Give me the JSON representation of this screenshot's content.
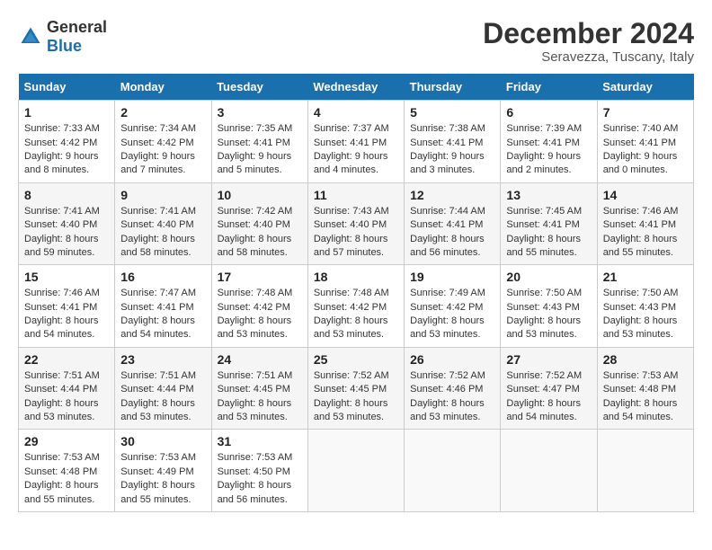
{
  "header": {
    "logo_general": "General",
    "logo_blue": "Blue",
    "month": "December 2024",
    "location": "Seravezza, Tuscany, Italy"
  },
  "weekdays": [
    "Sunday",
    "Monday",
    "Tuesday",
    "Wednesday",
    "Thursday",
    "Friday",
    "Saturday"
  ],
  "weeks": [
    [
      {
        "day": "1",
        "sunrise": "7:33 AM",
        "sunset": "4:42 PM",
        "daylight": "9 hours and 8 minutes."
      },
      {
        "day": "2",
        "sunrise": "7:34 AM",
        "sunset": "4:42 PM",
        "daylight": "9 hours and 7 minutes."
      },
      {
        "day": "3",
        "sunrise": "7:35 AM",
        "sunset": "4:41 PM",
        "daylight": "9 hours and 5 minutes."
      },
      {
        "day": "4",
        "sunrise": "7:37 AM",
        "sunset": "4:41 PM",
        "daylight": "9 hours and 4 minutes."
      },
      {
        "day": "5",
        "sunrise": "7:38 AM",
        "sunset": "4:41 PM",
        "daylight": "9 hours and 3 minutes."
      },
      {
        "day": "6",
        "sunrise": "7:39 AM",
        "sunset": "4:41 PM",
        "daylight": "9 hours and 2 minutes."
      },
      {
        "day": "7",
        "sunrise": "7:40 AM",
        "sunset": "4:41 PM",
        "daylight": "9 hours and 0 minutes."
      }
    ],
    [
      {
        "day": "8",
        "sunrise": "7:41 AM",
        "sunset": "4:40 PM",
        "daylight": "8 hours and 59 minutes."
      },
      {
        "day": "9",
        "sunrise": "7:41 AM",
        "sunset": "4:40 PM",
        "daylight": "8 hours and 58 minutes."
      },
      {
        "day": "10",
        "sunrise": "7:42 AM",
        "sunset": "4:40 PM",
        "daylight": "8 hours and 58 minutes."
      },
      {
        "day": "11",
        "sunrise": "7:43 AM",
        "sunset": "4:40 PM",
        "daylight": "8 hours and 57 minutes."
      },
      {
        "day": "12",
        "sunrise": "7:44 AM",
        "sunset": "4:41 PM",
        "daylight": "8 hours and 56 minutes."
      },
      {
        "day": "13",
        "sunrise": "7:45 AM",
        "sunset": "4:41 PM",
        "daylight": "8 hours and 55 minutes."
      },
      {
        "day": "14",
        "sunrise": "7:46 AM",
        "sunset": "4:41 PM",
        "daylight": "8 hours and 55 minutes."
      }
    ],
    [
      {
        "day": "15",
        "sunrise": "7:46 AM",
        "sunset": "4:41 PM",
        "daylight": "8 hours and 54 minutes."
      },
      {
        "day": "16",
        "sunrise": "7:47 AM",
        "sunset": "4:41 PM",
        "daylight": "8 hours and 54 minutes."
      },
      {
        "day": "17",
        "sunrise": "7:48 AM",
        "sunset": "4:42 PM",
        "daylight": "8 hours and 53 minutes."
      },
      {
        "day": "18",
        "sunrise": "7:48 AM",
        "sunset": "4:42 PM",
        "daylight": "8 hours and 53 minutes."
      },
      {
        "day": "19",
        "sunrise": "7:49 AM",
        "sunset": "4:42 PM",
        "daylight": "8 hours and 53 minutes."
      },
      {
        "day": "20",
        "sunrise": "7:50 AM",
        "sunset": "4:43 PM",
        "daylight": "8 hours and 53 minutes."
      },
      {
        "day": "21",
        "sunrise": "7:50 AM",
        "sunset": "4:43 PM",
        "daylight": "8 hours and 53 minutes."
      }
    ],
    [
      {
        "day": "22",
        "sunrise": "7:51 AM",
        "sunset": "4:44 PM",
        "daylight": "8 hours and 53 minutes."
      },
      {
        "day": "23",
        "sunrise": "7:51 AM",
        "sunset": "4:44 PM",
        "daylight": "8 hours and 53 minutes."
      },
      {
        "day": "24",
        "sunrise": "7:51 AM",
        "sunset": "4:45 PM",
        "daylight": "8 hours and 53 minutes."
      },
      {
        "day": "25",
        "sunrise": "7:52 AM",
        "sunset": "4:45 PM",
        "daylight": "8 hours and 53 minutes."
      },
      {
        "day": "26",
        "sunrise": "7:52 AM",
        "sunset": "4:46 PM",
        "daylight": "8 hours and 53 minutes."
      },
      {
        "day": "27",
        "sunrise": "7:52 AM",
        "sunset": "4:47 PM",
        "daylight": "8 hours and 54 minutes."
      },
      {
        "day": "28",
        "sunrise": "7:53 AM",
        "sunset": "4:48 PM",
        "daylight": "8 hours and 54 minutes."
      }
    ],
    [
      {
        "day": "29",
        "sunrise": "7:53 AM",
        "sunset": "4:48 PM",
        "daylight": "8 hours and 55 minutes."
      },
      {
        "day": "30",
        "sunrise": "7:53 AM",
        "sunset": "4:49 PM",
        "daylight": "8 hours and 55 minutes."
      },
      {
        "day": "31",
        "sunrise": "7:53 AM",
        "sunset": "4:50 PM",
        "daylight": "8 hours and 56 minutes."
      },
      null,
      null,
      null,
      null
    ]
  ]
}
